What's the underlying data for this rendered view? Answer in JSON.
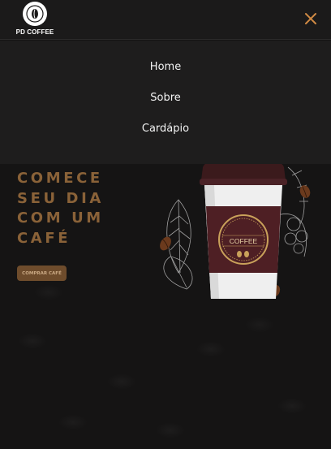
{
  "header": {
    "logo_text": "PD COFFEE",
    "logo_icon": "coffee-bean-icon",
    "close_icon": "close-icon"
  },
  "menu": {
    "items": [
      {
        "label": "Home"
      },
      {
        "label": "Sobre"
      },
      {
        "label": "Cardápio"
      }
    ]
  },
  "hero": {
    "title_lines": [
      "COMECE",
      "SEU DIA",
      "COM UM",
      "CAFÉ"
    ],
    "cta_label": "COMPRAR CAFÉ",
    "cup_label": "COFFEE"
  },
  "colors": {
    "accent": "#d08a44",
    "title": "#8a6238",
    "cta_bg": "#6e4c2c",
    "cup_sleeve": "#4e1f24",
    "background": "#141313"
  }
}
